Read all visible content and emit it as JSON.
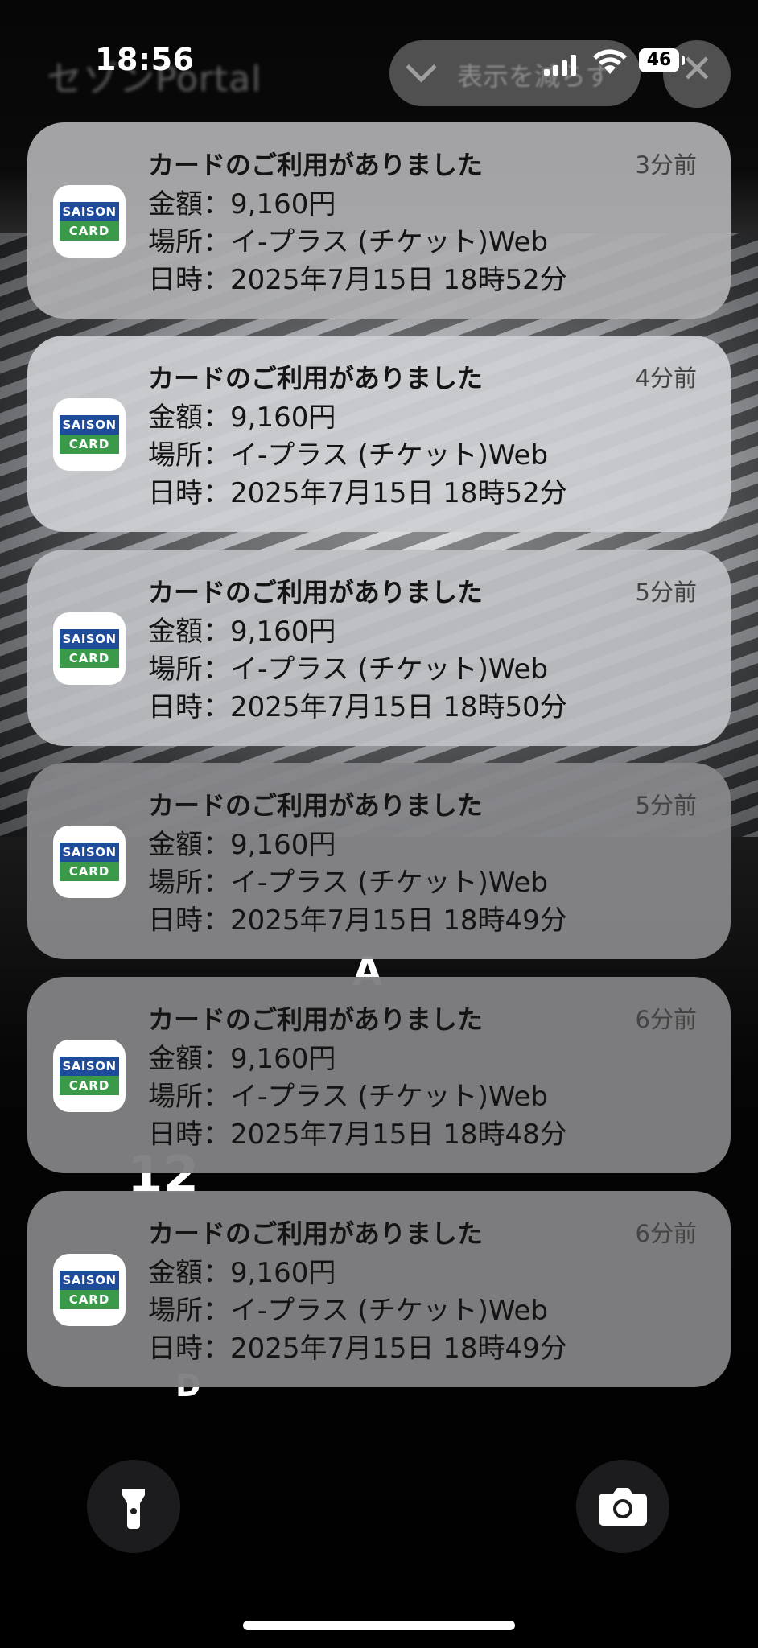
{
  "status_bar": {
    "time": "18:56",
    "battery": "46",
    "background_app_label": "セゾンPortal",
    "background_pill_label": "表示を減らす"
  },
  "notifications": [
    {
      "app": "SAISON CARD",
      "title": "カードのご利用がありました",
      "age": "3分前",
      "amount": "金額：9,160円",
      "place": "場所：イ-プラス (チケット)Web",
      "datetime": "日時：2025年7月15日 18時52分"
    },
    {
      "app": "SAISON CARD",
      "title": "カードのご利用がありました",
      "age": "4分前",
      "amount": "金額：9,160円",
      "place": "場所：イ-プラス (チケット)Web",
      "datetime": "日時：2025年7月15日 18時52分"
    },
    {
      "app": "SAISON CARD",
      "title": "カードのご利用がありました",
      "age": "5分前",
      "amount": "金額：9,160円",
      "place": "場所：イ-プラス (チケット)Web",
      "datetime": "日時：2025年7月15日 18時50分"
    },
    {
      "app": "SAISON CARD",
      "title": "カードのご利用がありました",
      "age": "5分前",
      "amount": "金額：9,160円",
      "place": "場所：イ-プラス (チケット)Web",
      "datetime": "日時：2025年7月15日 18時49分"
    },
    {
      "app": "SAISON CARD",
      "title": "カードのご利用がありました",
      "age": "6分前",
      "amount": "金額：9,160円",
      "place": "場所：イ-プラス (チケット)Web",
      "datetime": "日時：2025年7月15日 18時48分"
    },
    {
      "app": "SAISON CARD",
      "title": "カードのご利用がありました",
      "age": "6分前",
      "amount": "金額：9,160円",
      "place": "場所：イ-プラス (チケット)Web",
      "datetime": "日時：2025年7月15日 18時49分"
    }
  ],
  "logo": {
    "top": "SAISON",
    "bottom": "CARD",
    "top_color": "#1f4b9b",
    "bottom_color": "#3a9a4a"
  },
  "controls": {
    "left_icon": "flashlight-icon",
    "right_icon": "camera-icon"
  }
}
